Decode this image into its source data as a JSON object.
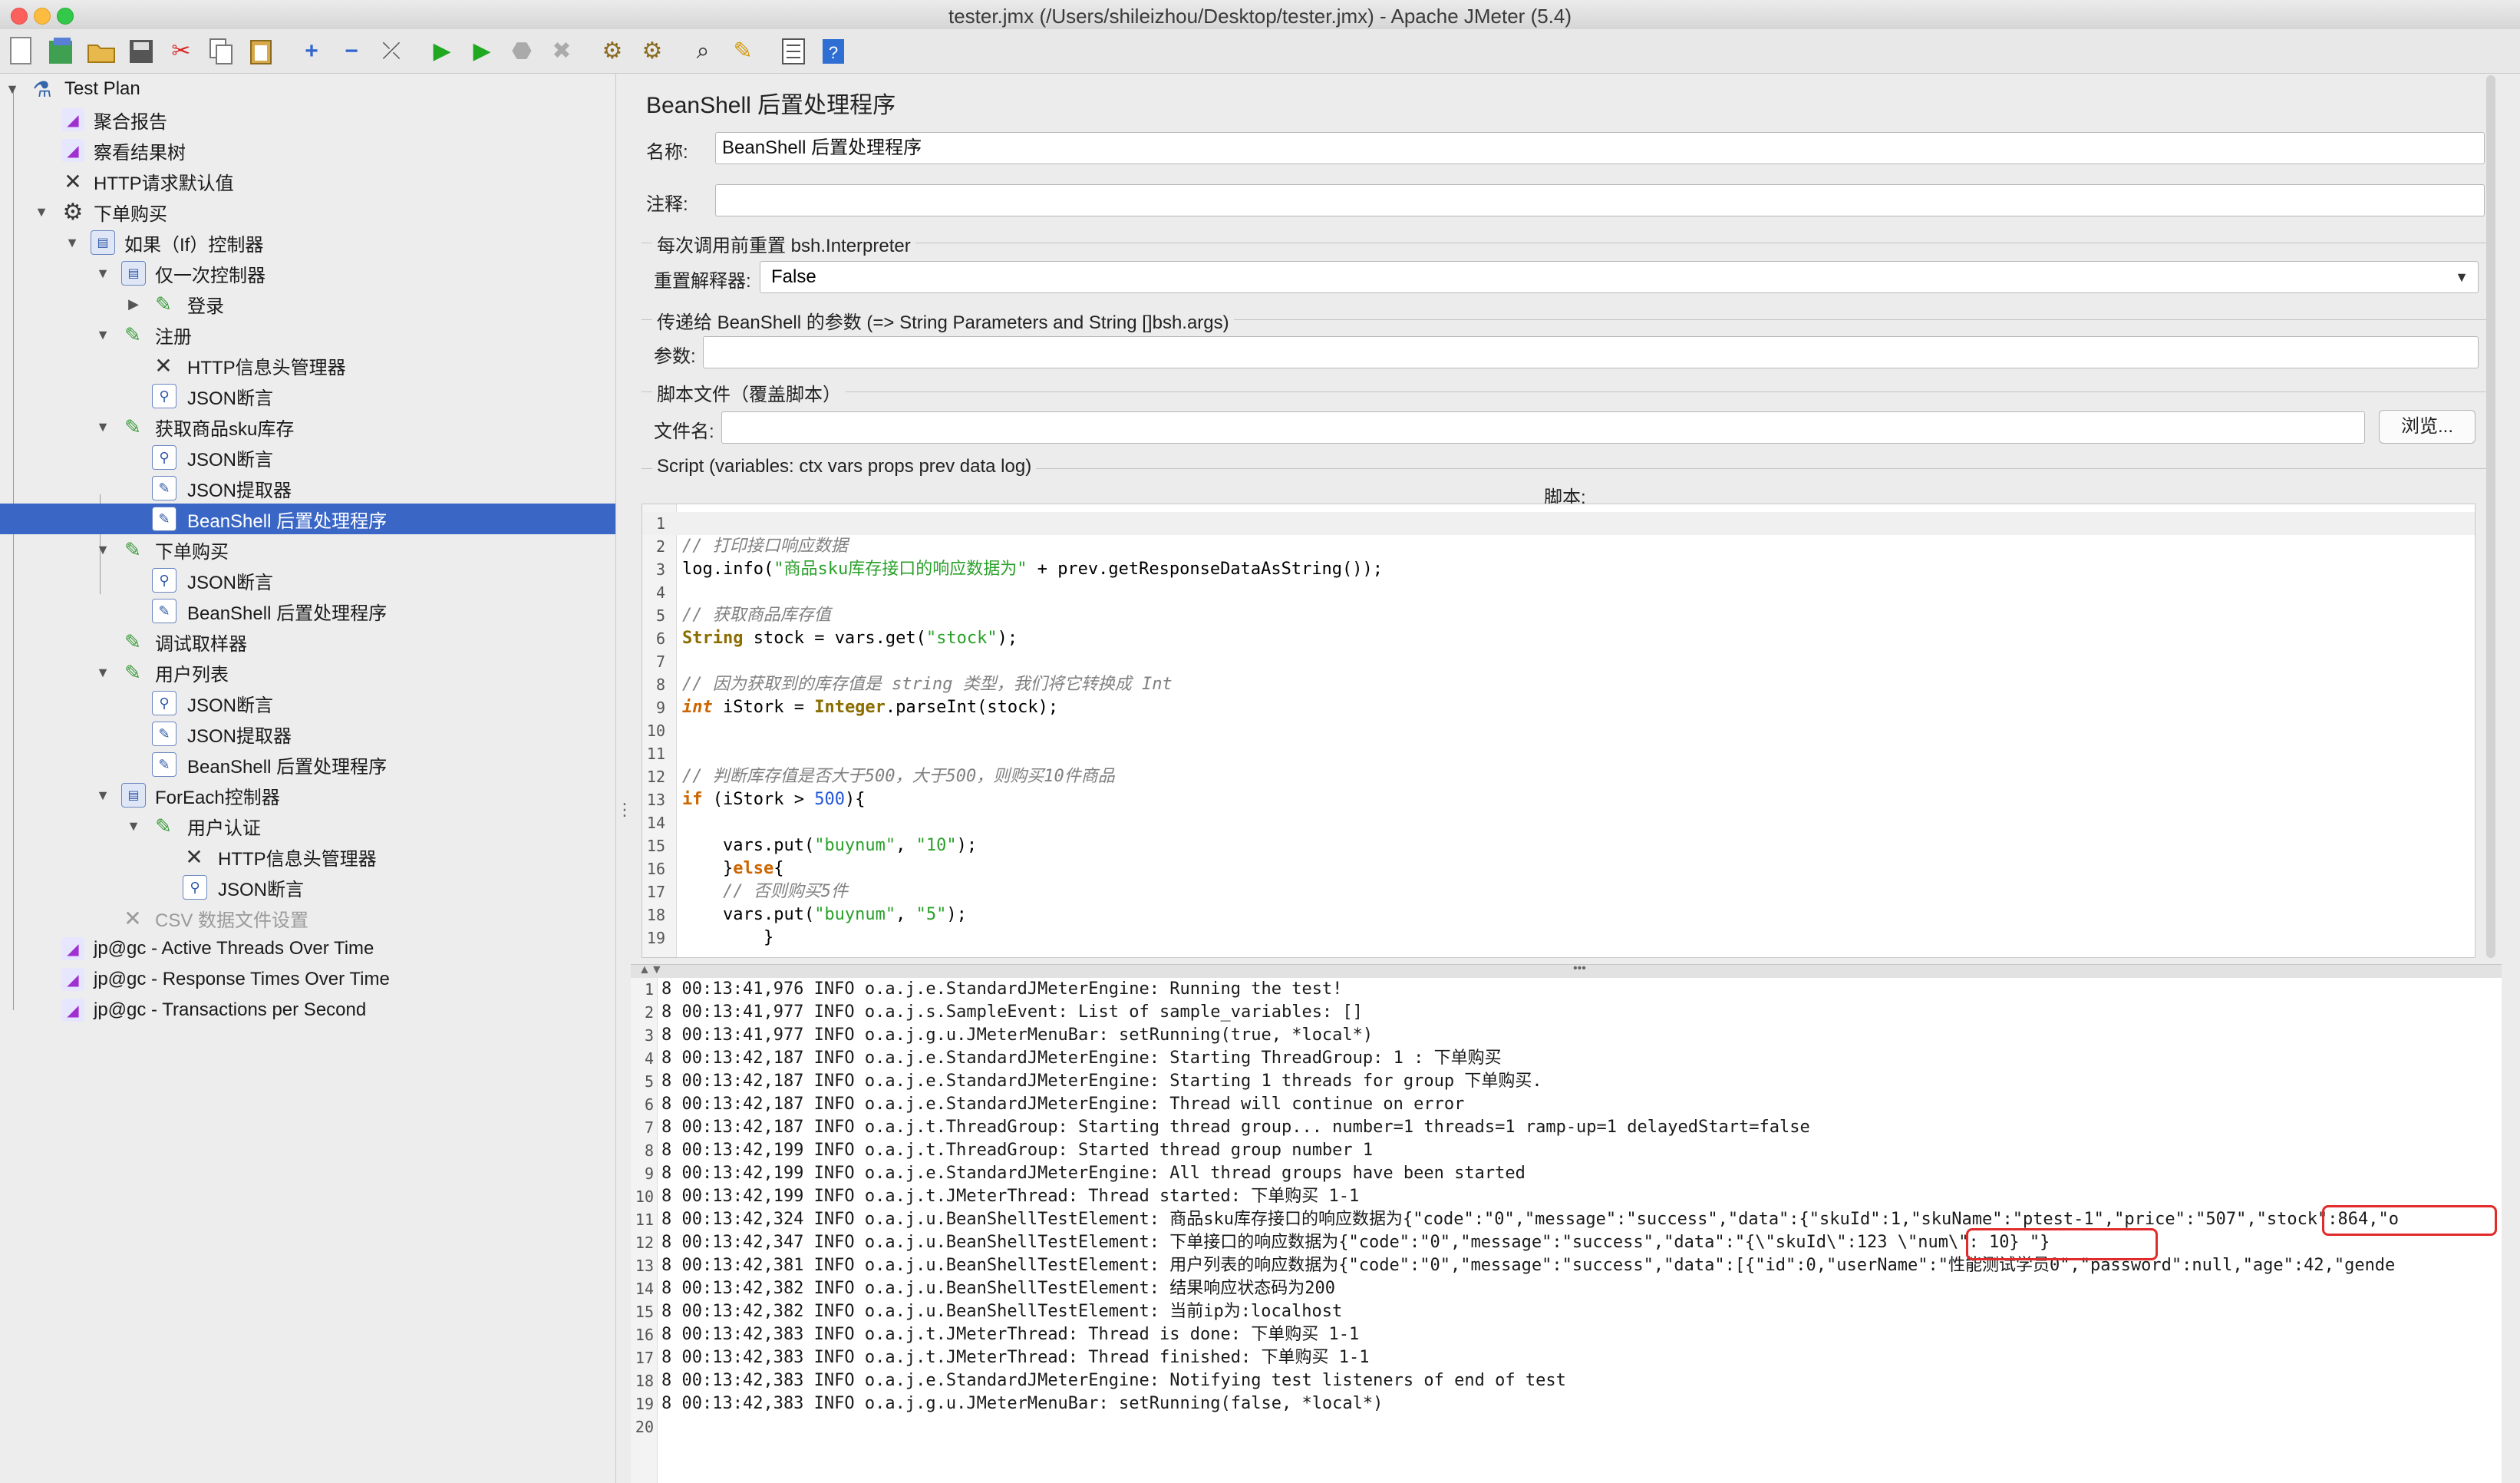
{
  "window": {
    "title": "tester.jmx (/Users/shileizhou/Desktop/tester.jmx) - Apache JMeter (5.4)"
  },
  "toolbar": {
    "buttons": [
      "new-icon",
      "templates-icon",
      "open-icon",
      "save-icon",
      "cut-icon",
      "copy-icon",
      "paste-icon",
      "expand-icon",
      "collapse-icon",
      "toggle-icon",
      "start-icon",
      "start-no-pause-icon",
      "stop-icon",
      "shutdown-icon",
      "clear-icon",
      "clear-all-icon",
      "search-icon",
      "reset-search-icon",
      "function-helper-icon",
      "help-icon"
    ]
  },
  "tree": {
    "items": [
      {
        "label": "Test Plan"
      },
      {
        "label": "聚合报告"
      },
      {
        "label": "察看结果树"
      },
      {
        "label": "HTTP请求默认值"
      },
      {
        "label": "下单购买"
      },
      {
        "label": "如果（If）控制器"
      },
      {
        "label": "仅一次控制器"
      },
      {
        "label": "登录"
      },
      {
        "label": "注册"
      },
      {
        "label": "HTTP信息头管理器"
      },
      {
        "label": "JSON断言"
      },
      {
        "label": "获取商品sku库存"
      },
      {
        "label": "JSON断言"
      },
      {
        "label": "JSON提取器"
      },
      {
        "label": "BeanShell 后置处理程序"
      },
      {
        "label": "下单购买"
      },
      {
        "label": "JSON断言"
      },
      {
        "label": "BeanShell 后置处理程序"
      },
      {
        "label": "调试取样器"
      },
      {
        "label": "用户列表"
      },
      {
        "label": "JSON断言"
      },
      {
        "label": "JSON提取器"
      },
      {
        "label": "BeanShell 后置处理程序"
      },
      {
        "label": "ForEach控制器"
      },
      {
        "label": "用户认证"
      },
      {
        "label": "HTTP信息头管理器"
      },
      {
        "label": "JSON断言"
      },
      {
        "label": "CSV 数据文件设置"
      },
      {
        "label": "jp@gc - Active Threads Over Time"
      },
      {
        "label": "jp@gc - Response Times Over Time"
      },
      {
        "label": "jp@gc - Transactions per Second"
      }
    ]
  },
  "panel": {
    "title": "BeanShell 后置处理程序",
    "name_label": "名称:",
    "name_value": "BeanShell 后置处理程序",
    "comment_label": "注释:",
    "comment_value": "",
    "reset_group": "每次调用前重置 bsh.Interpreter",
    "reset_label": "重置解释器:",
    "reset_value": "False",
    "params_group": "传递给 BeanShell 的参数 (=> String Parameters and String []bsh.args)",
    "params_label": "参数:",
    "params_value": "",
    "file_group": "脚本文件（覆盖脚本）",
    "file_label": "文件名:",
    "file_value": "",
    "browse_button": "浏览...",
    "script_group": "Script (variables: ctx vars props prev data log)",
    "script_header": "脚本:"
  },
  "script_lines": [
    "",
    "// 打印接口响应数据",
    "log.info(\"商品sku库存接口的响应数据为\" + prev.getResponseDataAsString());",
    "",
    "// 获取商品库存值",
    "String stock = vars.get(\"stock\");",
    "",
    "// 因为获取到的库存值是 string 类型，我们将它转换成 Int",
    "int iStork = Integer.parseInt(stock);",
    "",
    "",
    "// 判断库存值是否大于500，大于500，则购买10件商品",
    "if (iStork > 500){",
    "",
    "    vars.put(\"buynum\", \"10\");",
    "    }else{",
    "    // 否则购买5件",
    "    vars.put(\"buynum\", \"5\");",
    "        }"
  ],
  "log_lines": [
    "8 00:13:41,976 INFO o.a.j.e.StandardJMeterEngine: Running the test!",
    "8 00:13:41,977 INFO o.a.j.s.SampleEvent: List of sample_variables: []",
    "8 00:13:41,977 INFO o.a.j.g.u.JMeterMenuBar: setRunning(true, *local*)",
    "8 00:13:42,187 INFO o.a.j.e.StandardJMeterEngine: Starting ThreadGroup: 1 : 下单购买",
    "8 00:13:42,187 INFO o.a.j.e.StandardJMeterEngine: Starting 1 threads for group 下单购买.",
    "8 00:13:42,187 INFO o.a.j.e.StandardJMeterEngine: Thread will continue on error",
    "8 00:13:42,187 INFO o.a.j.t.ThreadGroup: Starting thread group... number=1 threads=1 ramp-up=1 delayedStart=false",
    "8 00:13:42,199 INFO o.a.j.t.ThreadGroup: Started thread group number 1",
    "8 00:13:42,199 INFO o.a.j.e.StandardJMeterEngine: All thread groups have been started",
    "8 00:13:42,199 INFO o.a.j.t.JMeterThread: Thread started: 下单购买 1-1",
    "8 00:13:42,324 INFO o.a.j.u.BeanShellTestElement: 商品sku库存接口的响应数据为{\"code\":\"0\",\"message\":\"success\",\"data\":{\"skuId\":1,\"skuName\":\"ptest-1\",\"price\":\"507\",\"stock\":864,\"o",
    "8 00:13:42,347 INFO o.a.j.u.BeanShellTestElement: 下单接口的响应数据为{\"code\":\"0\",\"message\":\"success\",\"data\":\"{\\\"skuId\\\":123 \\\"num\\\": 10} \"}",
    "8 00:13:42,381 INFO o.a.j.u.BeanShellTestElement: 用户列表的响应数据为{\"code\":\"0\",\"message\":\"success\",\"data\":[{\"id\":0,\"userName\":\"性能测试学员0\",\"password\":null,\"age\":42,\"gende",
    "8 00:13:42,382 INFO o.a.j.u.BeanShellTestElement: 结果响应状态码为200",
    "8 00:13:42,382 INFO o.a.j.u.BeanShellTestElement: 当前ip为:localhost",
    "8 00:13:42,383 INFO o.a.j.t.JMeterThread: Thread is done: 下单购买 1-1",
    "8 00:13:42,383 INFO o.a.j.t.JMeterThread: Thread finished: 下单购买 1-1",
    "8 00:13:42,383 INFO o.a.j.e.StandardJMeterEngine: Notifying test listeners of end of test",
    "8 00:13:42,383 INFO o.a.j.g.u.JMeterMenuBar: setRunning(false, *local*)",
    ""
  ],
  "colors": {
    "selection": "#3a66c6",
    "highlight_box": "#e12b2b"
  }
}
